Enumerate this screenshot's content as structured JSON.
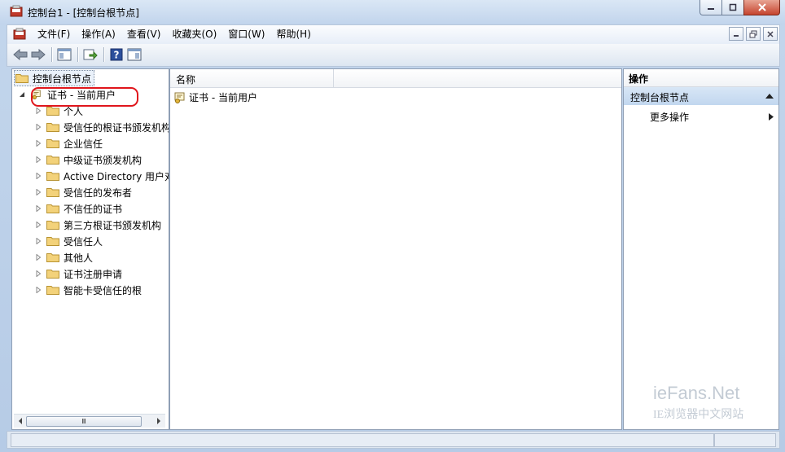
{
  "window": {
    "title": "控制台1 - [控制台根节点]",
    "controls": {
      "minimize": "minimize",
      "maximize": "maximize",
      "close": "close"
    }
  },
  "menu": {
    "items": [
      {
        "label": "文件(F)"
      },
      {
        "label": "操作(A)"
      },
      {
        "label": "查看(V)"
      },
      {
        "label": "收藏夹(O)"
      },
      {
        "label": "窗口(W)"
      },
      {
        "label": "帮助(H)"
      }
    ]
  },
  "toolbar": {
    "buttons": [
      "back-icon",
      "forward-icon",
      "show-hide-tree-icon",
      "export-list-icon",
      "help-icon",
      "show-hide-action-pane-icon"
    ]
  },
  "tree": {
    "root": "控制台根节点",
    "selected": "证书 - 当前用户",
    "children": [
      "个人",
      "受信任的根证书颁发机构",
      "企业信任",
      "中级证书颁发机构",
      "Active Directory 用户对",
      "受信任的发布者",
      "不信任的证书",
      "第三方根证书颁发机构",
      "受信任人",
      "其他人",
      "证书注册申请",
      "智能卡受信任的根"
    ],
    "scroll_thumb": "Ⅲ"
  },
  "list": {
    "column_name": "名称",
    "rows": [
      "证书 - 当前用户"
    ]
  },
  "actions": {
    "header": "操作",
    "section": "控制台根节点",
    "item": "更多操作"
  },
  "watermark": {
    "line1": "ieFans.Net",
    "line2": "IE浏览器中文网站"
  },
  "colors": {
    "highlight_ring": "#e0161c",
    "action_section": "#c2d7ef",
    "folder": "#f3d27a"
  }
}
